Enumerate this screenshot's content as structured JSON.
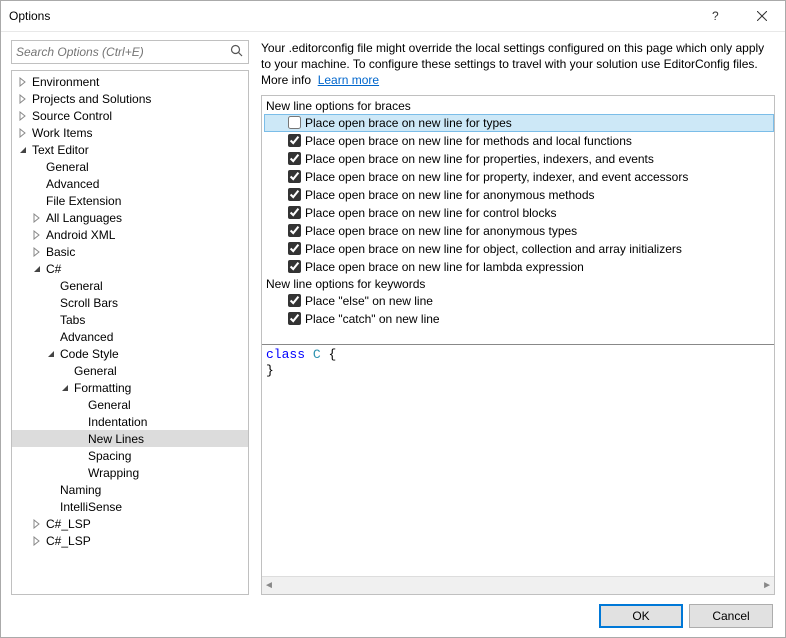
{
  "window": {
    "title": "Options"
  },
  "search": {
    "placeholder": "Search Options (Ctrl+E)"
  },
  "tree": {
    "items": [
      {
        "label": "Environment",
        "depth": 1,
        "arrow": "closed"
      },
      {
        "label": "Projects and Solutions",
        "depth": 1,
        "arrow": "closed"
      },
      {
        "label": "Source Control",
        "depth": 1,
        "arrow": "closed"
      },
      {
        "label": "Work Items",
        "depth": 1,
        "arrow": "closed"
      },
      {
        "label": "Text Editor",
        "depth": 1,
        "arrow": "open"
      },
      {
        "label": "General",
        "depth": 2,
        "arrow": "none"
      },
      {
        "label": "Advanced",
        "depth": 2,
        "arrow": "none"
      },
      {
        "label": "File Extension",
        "depth": 2,
        "arrow": "none"
      },
      {
        "label": "All Languages",
        "depth": 2,
        "arrow": "closed"
      },
      {
        "label": "Android XML",
        "depth": 2,
        "arrow": "closed"
      },
      {
        "label": "Basic",
        "depth": 2,
        "arrow": "closed"
      },
      {
        "label": "C#",
        "depth": 2,
        "arrow": "open"
      },
      {
        "label": "General",
        "depth": 3,
        "arrow": "none"
      },
      {
        "label": "Scroll Bars",
        "depth": 3,
        "arrow": "none"
      },
      {
        "label": "Tabs",
        "depth": 3,
        "arrow": "none"
      },
      {
        "label": "Advanced",
        "depth": 3,
        "arrow": "none"
      },
      {
        "label": "Code Style",
        "depth": 3,
        "arrow": "open"
      },
      {
        "label": "General",
        "depth": 4,
        "arrow": "none"
      },
      {
        "label": "Formatting",
        "depth": 4,
        "arrow": "open"
      },
      {
        "label": "General",
        "depth": 5,
        "arrow": "none"
      },
      {
        "label": "Indentation",
        "depth": 5,
        "arrow": "none"
      },
      {
        "label": "New Lines",
        "depth": 5,
        "arrow": "none",
        "selected": true
      },
      {
        "label": "Spacing",
        "depth": 5,
        "arrow": "none"
      },
      {
        "label": "Wrapping",
        "depth": 5,
        "arrow": "none"
      },
      {
        "label": "Naming",
        "depth": 3,
        "arrow": "none"
      },
      {
        "label": "IntelliSense",
        "depth": 3,
        "arrow": "none"
      },
      {
        "label": "C#_LSP",
        "depth": 2,
        "arrow": "closed"
      },
      {
        "label": "C#_LSP",
        "depth": 2,
        "arrow": "closed"
      }
    ]
  },
  "intro": {
    "text": "Your .editorconfig file might override the local settings configured on this page which only apply to your machine. To configure these settings to travel with your solution use EditorConfig files. More info",
    "link": "Learn more"
  },
  "options": {
    "groups": [
      {
        "title": "New line options for braces",
        "items": [
          {
            "label": "Place open brace on new line for types",
            "checked": false,
            "selected": true
          },
          {
            "label": "Place open brace on new line for methods and local functions",
            "checked": true
          },
          {
            "label": "Place open brace on new line for properties, indexers, and events",
            "checked": true
          },
          {
            "label": "Place open brace on new line for property, indexer, and event accessors",
            "checked": true
          },
          {
            "label": "Place open brace on new line for anonymous methods",
            "checked": true
          },
          {
            "label": "Place open brace on new line for control blocks",
            "checked": true
          },
          {
            "label": "Place open brace on new line for anonymous types",
            "checked": true
          },
          {
            "label": "Place open brace on new line for object, collection and array initializers",
            "checked": true
          },
          {
            "label": "Place open brace on new line for lambda expression",
            "checked": true
          }
        ]
      },
      {
        "title": "New line options for keywords",
        "items": [
          {
            "label": "Place \"else\" on new line",
            "checked": true
          },
          {
            "label": "Place \"catch\" on new line",
            "checked": true
          }
        ]
      }
    ]
  },
  "preview": {
    "keyword": "class",
    "typename": "C",
    "open": " {",
    "close": "}"
  },
  "buttons": {
    "ok": "OK",
    "cancel": "Cancel"
  }
}
